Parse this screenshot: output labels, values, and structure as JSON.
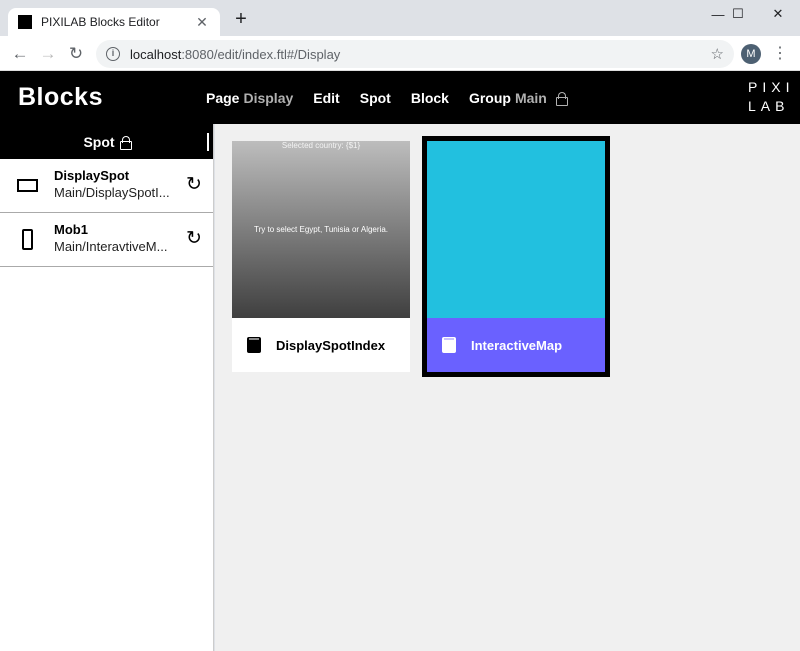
{
  "browser": {
    "tab_title": "PIXILAB Blocks Editor",
    "tab_close": "✕",
    "new_tab": "+",
    "url_host": "localhost",
    "url_rest": ":8080/edit/index.ftl#/Display",
    "avatar_letter": "M",
    "controls": {
      "minimize": "—",
      "maximize": "☐",
      "close": "✕"
    }
  },
  "app": {
    "logo": "Blocks",
    "brand_line1": "PIXI",
    "brand_line2": "LAB",
    "menu": {
      "page_label": "Page",
      "page_value": "Display",
      "edit_label": "Edit",
      "spot_label": "Spot",
      "block_label": "Block",
      "group_label": "Group",
      "group_value": "Main"
    }
  },
  "sidebar": {
    "header": "Spot",
    "spots": [
      {
        "name": "DisplaySpot",
        "path": "Main/DisplaySpotI...",
        "icon": "display-icon"
      },
      {
        "name": "Mob1",
        "path": "Main/InteravtiveM...",
        "icon": "mobile-icon"
      }
    ]
  },
  "main": {
    "cards": [
      {
        "label": "DisplaySpotIndex",
        "preview_top": "Selected country: {$1}",
        "preview_mid": "Try to select Egypt, Tunisia or Algeria."
      },
      {
        "label": "InteractiveMap"
      }
    ]
  },
  "colors": {
    "accent": "#6a61ff",
    "map_preview": "#22c0df",
    "appbar": "#000000"
  }
}
